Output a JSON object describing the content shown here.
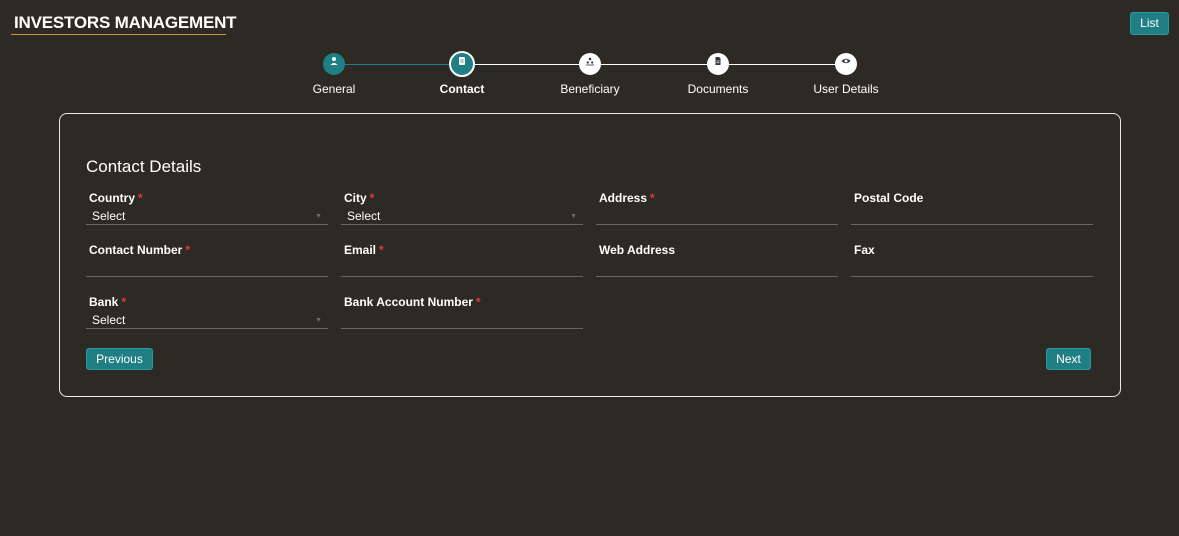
{
  "header": {
    "title": "INVESTORS MANAGEMENT",
    "list_label": "List"
  },
  "stepper": {
    "steps": [
      {
        "label": "General",
        "icon": "user-icon",
        "state": "completed"
      },
      {
        "label": "Contact",
        "icon": "contact-book-icon",
        "state": "active"
      },
      {
        "label": "Beneficiary",
        "icon": "people-icon",
        "state": "pending"
      },
      {
        "label": "Documents",
        "icon": "document-icon",
        "state": "pending"
      },
      {
        "label": "User Details",
        "icon": "eye-icon",
        "state": "pending"
      }
    ]
  },
  "form": {
    "section_title": "Contact Details",
    "required_marker": "*",
    "fields": {
      "country": {
        "label": "Country",
        "required": true,
        "value": "Select",
        "type": "select"
      },
      "city": {
        "label": "City",
        "required": true,
        "value": "Select",
        "type": "select"
      },
      "address": {
        "label": "Address",
        "required": true,
        "value": "",
        "type": "text"
      },
      "postal_code": {
        "label": "Postal Code",
        "required": false,
        "value": "",
        "type": "text"
      },
      "contact_number": {
        "label": "Contact Number",
        "required": true,
        "value": "",
        "type": "text"
      },
      "email": {
        "label": "Email",
        "required": true,
        "value": "",
        "type": "text"
      },
      "web_address": {
        "label": "Web Address",
        "required": false,
        "value": "",
        "type": "text"
      },
      "fax": {
        "label": "Fax",
        "required": false,
        "value": "",
        "type": "text"
      },
      "bank": {
        "label": "Bank",
        "required": true,
        "value": "Select",
        "type": "select"
      },
      "bank_account_number": {
        "label": "Bank Account Number",
        "required": true,
        "value": "",
        "type": "text"
      }
    },
    "previous_label": "Previous",
    "next_label": "Next"
  },
  "colors": {
    "background": "#2d2a26",
    "accent": "#1f7f84",
    "title_underline": "#c8963c",
    "required": "#e53935"
  }
}
